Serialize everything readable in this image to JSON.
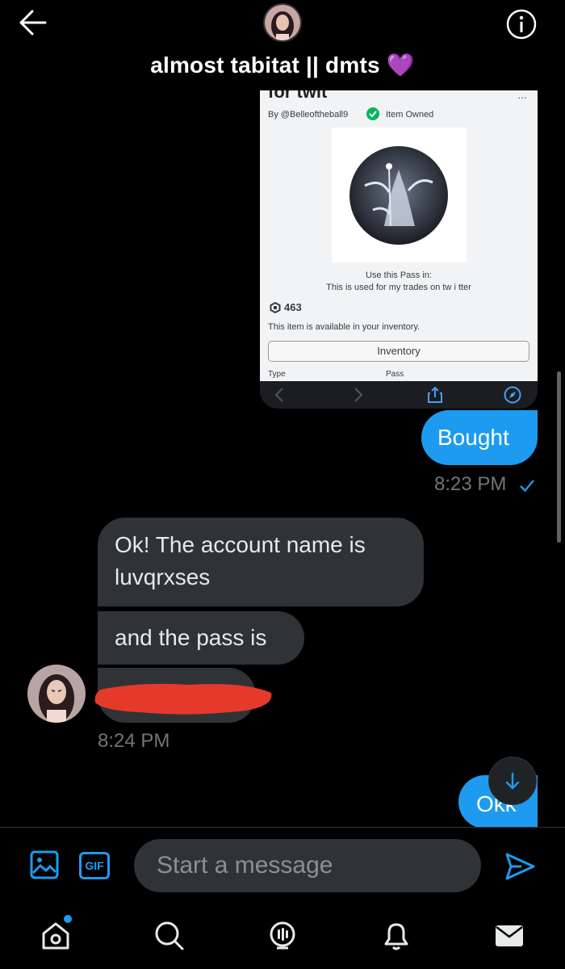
{
  "header": {
    "title": "almost tabitat || dmts",
    "title_emoji": "💜"
  },
  "shared_screenshot": {
    "title": "for twit",
    "menu": "···",
    "by": "By @Belleoftheball9",
    "owned": "Item Owned",
    "use_label": "Use this Pass in:",
    "use_description": "This is used for my trades on tw i tter",
    "price": "463",
    "availability": "This item is available in your inventory.",
    "inventory_button": "Inventory",
    "type_label": "Type",
    "type_value": "Pass"
  },
  "messages": {
    "bought": "Bought",
    "bought_time": "8:23 PM",
    "incoming_1": "Ok! The account name is luvqrxses",
    "incoming_2": "and the pass is",
    "incoming_time": "8:24 PM",
    "okk": "Okk"
  },
  "composer": {
    "gif_label": "GIF",
    "placeholder": "Start a message"
  },
  "colors": {
    "accent": "#1d9bf0",
    "bubble_in": "#2f3336",
    "redaction": "#e53a2b"
  },
  "icons": [
    "back-arrow-icon",
    "info-icon",
    "check-icon",
    "share-icon",
    "compass-icon",
    "image-icon",
    "send-icon",
    "home-icon",
    "search-icon",
    "spaces-icon",
    "bell-icon",
    "mail-icon",
    "arrow-down-icon"
  ]
}
